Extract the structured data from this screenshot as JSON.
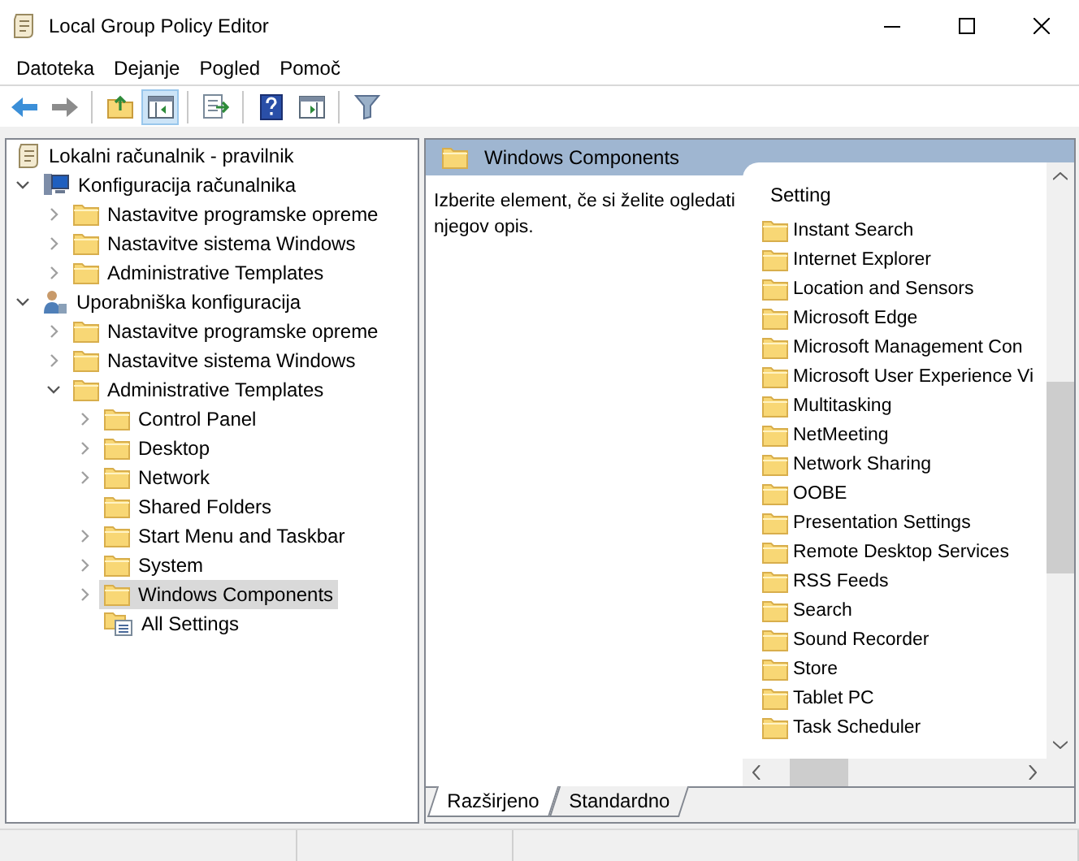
{
  "window": {
    "title": "Local Group Policy Editor"
  },
  "menu": [
    "Datoteka",
    "Dejanje",
    "Pogled",
    "Pomoč"
  ],
  "toolbar": [
    [
      {
        "pressed": false
      },
      {
        "pressed": false
      }
    ],
    [
      {
        "pressed": false
      },
      {
        "pressed": true
      }
    ],
    [
      {
        "pressed": false
      }
    ],
    [
      {
        "pressed": false
      },
      {
        "pressed": false
      }
    ],
    [
      {
        "pressed": false
      }
    ]
  ],
  "tree": {
    "label": "Lokalni računalnik - pravilnik",
    "kind": "policy",
    "selected": false,
    "children": [
      {
        "label": "Konfiguracija računalnika",
        "kind": "computer",
        "expandable": true,
        "expanded": true,
        "selected": false,
        "children": [
          {
            "label": "Nastavitve programske opreme",
            "kind": "folder",
            "expandable": true,
            "expanded": false,
            "selected": false
          },
          {
            "label": "Nastavitve sistema Windows",
            "kind": "folder",
            "expandable": true,
            "expanded": false,
            "selected": false
          },
          {
            "label": "Administrative Templates",
            "kind": "folder",
            "expandable": true,
            "expanded": false,
            "selected": false
          }
        ]
      },
      {
        "label": "Uporabniška konfiguracija",
        "kind": "user",
        "expandable": true,
        "expanded": true,
        "selected": false,
        "children": [
          {
            "label": "Nastavitve programske opreme",
            "kind": "folder",
            "expandable": true,
            "expanded": false,
            "selected": false
          },
          {
            "label": "Nastavitve sistema Windows",
            "kind": "folder",
            "expandable": true,
            "expanded": false,
            "selected": false
          },
          {
            "label": "Administrative Templates",
            "kind": "folder",
            "expandable": true,
            "expanded": true,
            "selected": false,
            "children": [
              {
                "label": "Control Panel",
                "kind": "folder",
                "expandable": true,
                "expanded": false,
                "selected": false
              },
              {
                "label": "Desktop",
                "kind": "folder",
                "expandable": true,
                "expanded": false,
                "selected": false
              },
              {
                "label": "Network",
                "kind": "folder",
                "expandable": true,
                "expanded": false,
                "selected": false
              },
              {
                "label": "Shared Folders",
                "kind": "folder",
                "selected": false
              },
              {
                "label": "Start Menu and Taskbar",
                "kind": "folder",
                "expandable": true,
                "expanded": false,
                "selected": false
              },
              {
                "label": "System",
                "kind": "folder",
                "expandable": true,
                "expanded": false,
                "selected": false
              },
              {
                "label": "Windows Components",
                "kind": "folder",
                "expandable": true,
                "expanded": false,
                "selected": true
              },
              {
                "label": "All Settings",
                "kind": "settings",
                "selected": false
              }
            ]
          }
        ]
      }
    ]
  },
  "details": {
    "title": "Windows Components",
    "description": "Izberite element, če si želite ogledati njegov opis.",
    "column": "Setting",
    "items": [
      "Instant Search",
      "Internet Explorer",
      "Location and Sensors",
      "Microsoft Edge",
      "Microsoft Management Con",
      "Microsoft User Experience Vi",
      "Multitasking",
      "NetMeeting",
      "Network Sharing",
      "OOBE",
      "Presentation Settings",
      "Remote Desktop Services",
      "RSS Feeds",
      "Search",
      "Sound Recorder",
      "Store",
      "Tablet PC",
      "Task Scheduler"
    ]
  },
  "tabs": [
    {
      "label": "Razširjeno",
      "selected": true
    },
    {
      "label": "Standardno",
      "selected": false
    }
  ]
}
